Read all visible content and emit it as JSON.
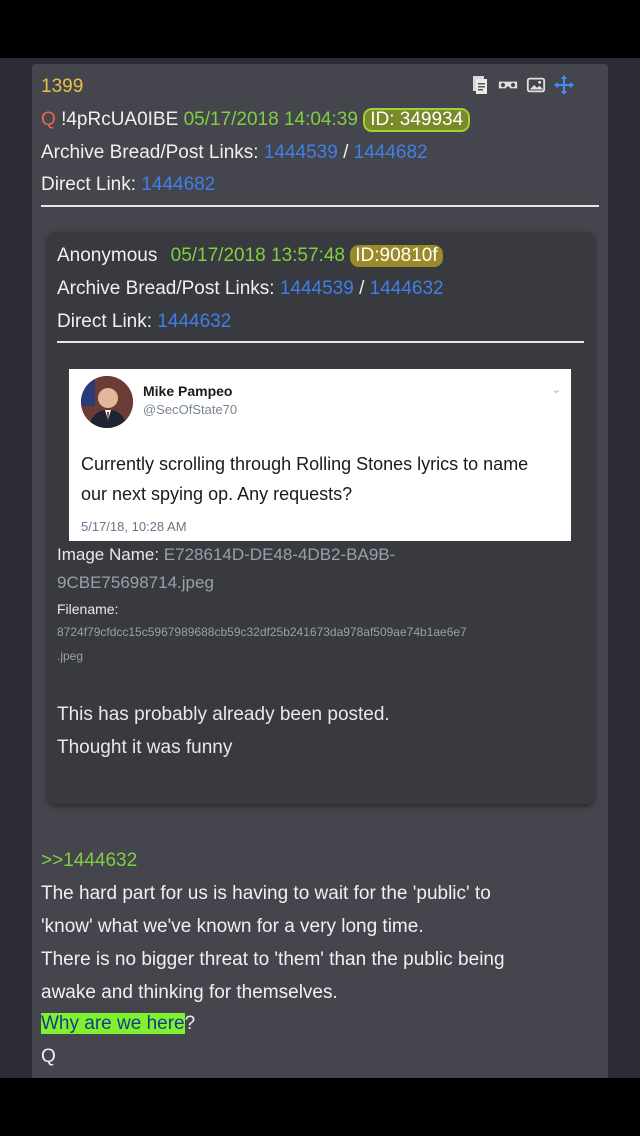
{
  "post": {
    "number": "1399",
    "q_label": "Q",
    "tripcode": "!4pRcUA0IBE",
    "datetime": "05/17/2018 14:04:39",
    "id": "ID: 349934",
    "archive_label": "Archive Bread/Post Links:",
    "archive_link1": "1444539",
    "separator": "/",
    "archive_link2": "1444682",
    "direct_label": "Direct Link:",
    "direct_link": "1444682",
    "reply_ref": ">>1444632",
    "body_lines": [
      "The hard part for us is having to wait for the 'public' to",
      "'know' what we've known for a very long time.",
      "There is no bigger threat to 'them' than the public being",
      "awake and thinking for themselves."
    ],
    "highlight_text": "Why are we here",
    "question_mark": "?",
    "signature": "Q"
  },
  "quoted": {
    "author": "Anonymous",
    "datetime": "05/17/2018 13:57:48",
    "id": "ID:90810f",
    "archive_label": "Archive Bread/Post Links:",
    "archive_link1": "1444539",
    "separator": "/",
    "archive_link2": "1444632",
    "direct_label": "Direct Link:",
    "direct_link": "1444632",
    "image_name_label": "Image Name:",
    "image_name_1": "E728614D-DE48-4DB2-BA9B-",
    "image_name_2": "9CBE75698714.jpeg",
    "filename_label": "Filename:",
    "filename_1": "8724f79cfdcc15c5967989688cb59c32df25b241673da978af509ae74b1ae6e7",
    "filename_2": ".jpeg",
    "body_lines": [
      "This has probably already been posted.",
      "Thought it was funny"
    ]
  },
  "tweet": {
    "name": "Mike Pampeo",
    "handle": "@SecOfState70",
    "text_1": "Currently scrolling through Rolling Stones lyrics to name",
    "text_2": "our next spying op. Any requests?",
    "timestamp": "5/17/18, 10:28 AM"
  },
  "icons": [
    "document-icon",
    "glasses-icon",
    "image-icon",
    "move-icon"
  ]
}
